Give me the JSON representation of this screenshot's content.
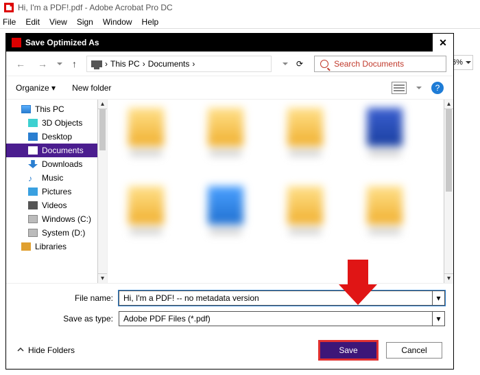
{
  "app": {
    "title": "Hi, I'm a PDF!.pdf - Adobe Acrobat Pro DC",
    "menus": [
      "File",
      "Edit",
      "View",
      "Sign",
      "Window",
      "Help"
    ],
    "zoom": "6%"
  },
  "dialog": {
    "title": "Save Optimized As",
    "nav": {
      "crumb1": "This PC",
      "crumb2": "Documents",
      "search_placeholder": "Search Documents"
    },
    "toolbar": {
      "organize": "Organize",
      "new_folder": "New folder"
    },
    "tree": [
      {
        "label": "This PC",
        "icon": "pc",
        "level": 0
      },
      {
        "label": "3D Objects",
        "icon": "obj3d",
        "level": 1
      },
      {
        "label": "Desktop",
        "icon": "desktop",
        "level": 1
      },
      {
        "label": "Documents",
        "icon": "docs",
        "level": 1,
        "selected": true
      },
      {
        "label": "Downloads",
        "icon": "down",
        "level": 1
      },
      {
        "label": "Music",
        "icon": "music",
        "level": 1
      },
      {
        "label": "Pictures",
        "icon": "pic",
        "level": 1
      },
      {
        "label": "Videos",
        "icon": "vid",
        "level": 1
      },
      {
        "label": "Windows (C:)",
        "icon": "drive",
        "level": 1
      },
      {
        "label": "System (D:)",
        "icon": "drive",
        "level": 1
      },
      {
        "label": "Libraries",
        "icon": "lib",
        "level": 0
      }
    ],
    "fields": {
      "filename_label": "File name:",
      "filename_value": "Hi, I'm a PDF! -- no metadata version",
      "type_label": "Save as type:",
      "type_value": "Adobe PDF Files (*.pdf)"
    },
    "footer": {
      "hide_folders": "Hide Folders",
      "save": "Save",
      "cancel": "Cancel"
    }
  }
}
